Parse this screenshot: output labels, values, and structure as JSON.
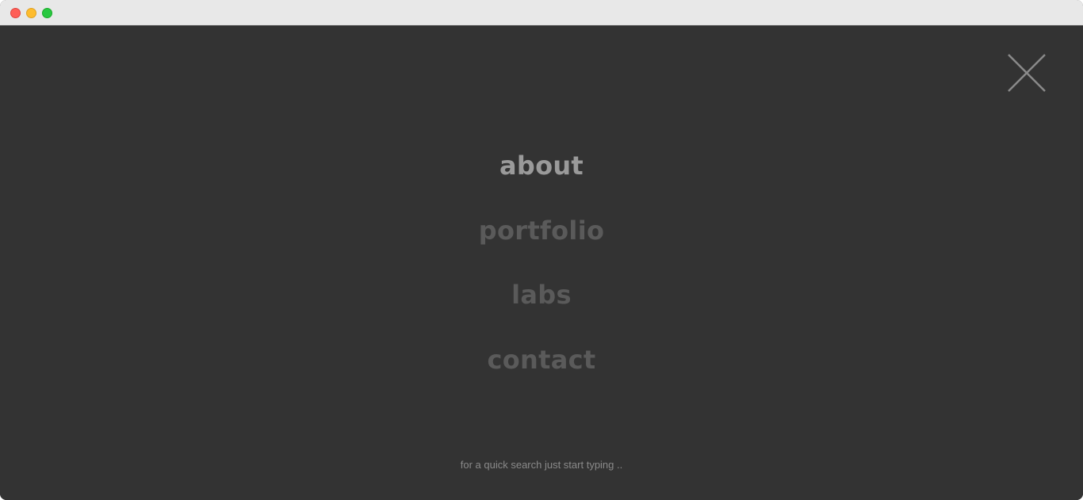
{
  "window": {
    "controls": [
      "close",
      "minimize",
      "maximize"
    ]
  },
  "overlay": {
    "close_icon": "close-icon",
    "menu": {
      "items": [
        {
          "label": "about",
          "active": true
        },
        {
          "label": "portfolio",
          "active": false
        },
        {
          "label": "labs",
          "active": false
        },
        {
          "label": "contact",
          "active": false
        }
      ]
    },
    "search_hint": "for a quick search just start typing .."
  },
  "colors": {
    "background": "#333333",
    "active_item": "#9a9a9a",
    "inactive_item": "#5a5a5a",
    "hint_text": "#8a8a8a",
    "close_icon": "#8a8a8a"
  }
}
